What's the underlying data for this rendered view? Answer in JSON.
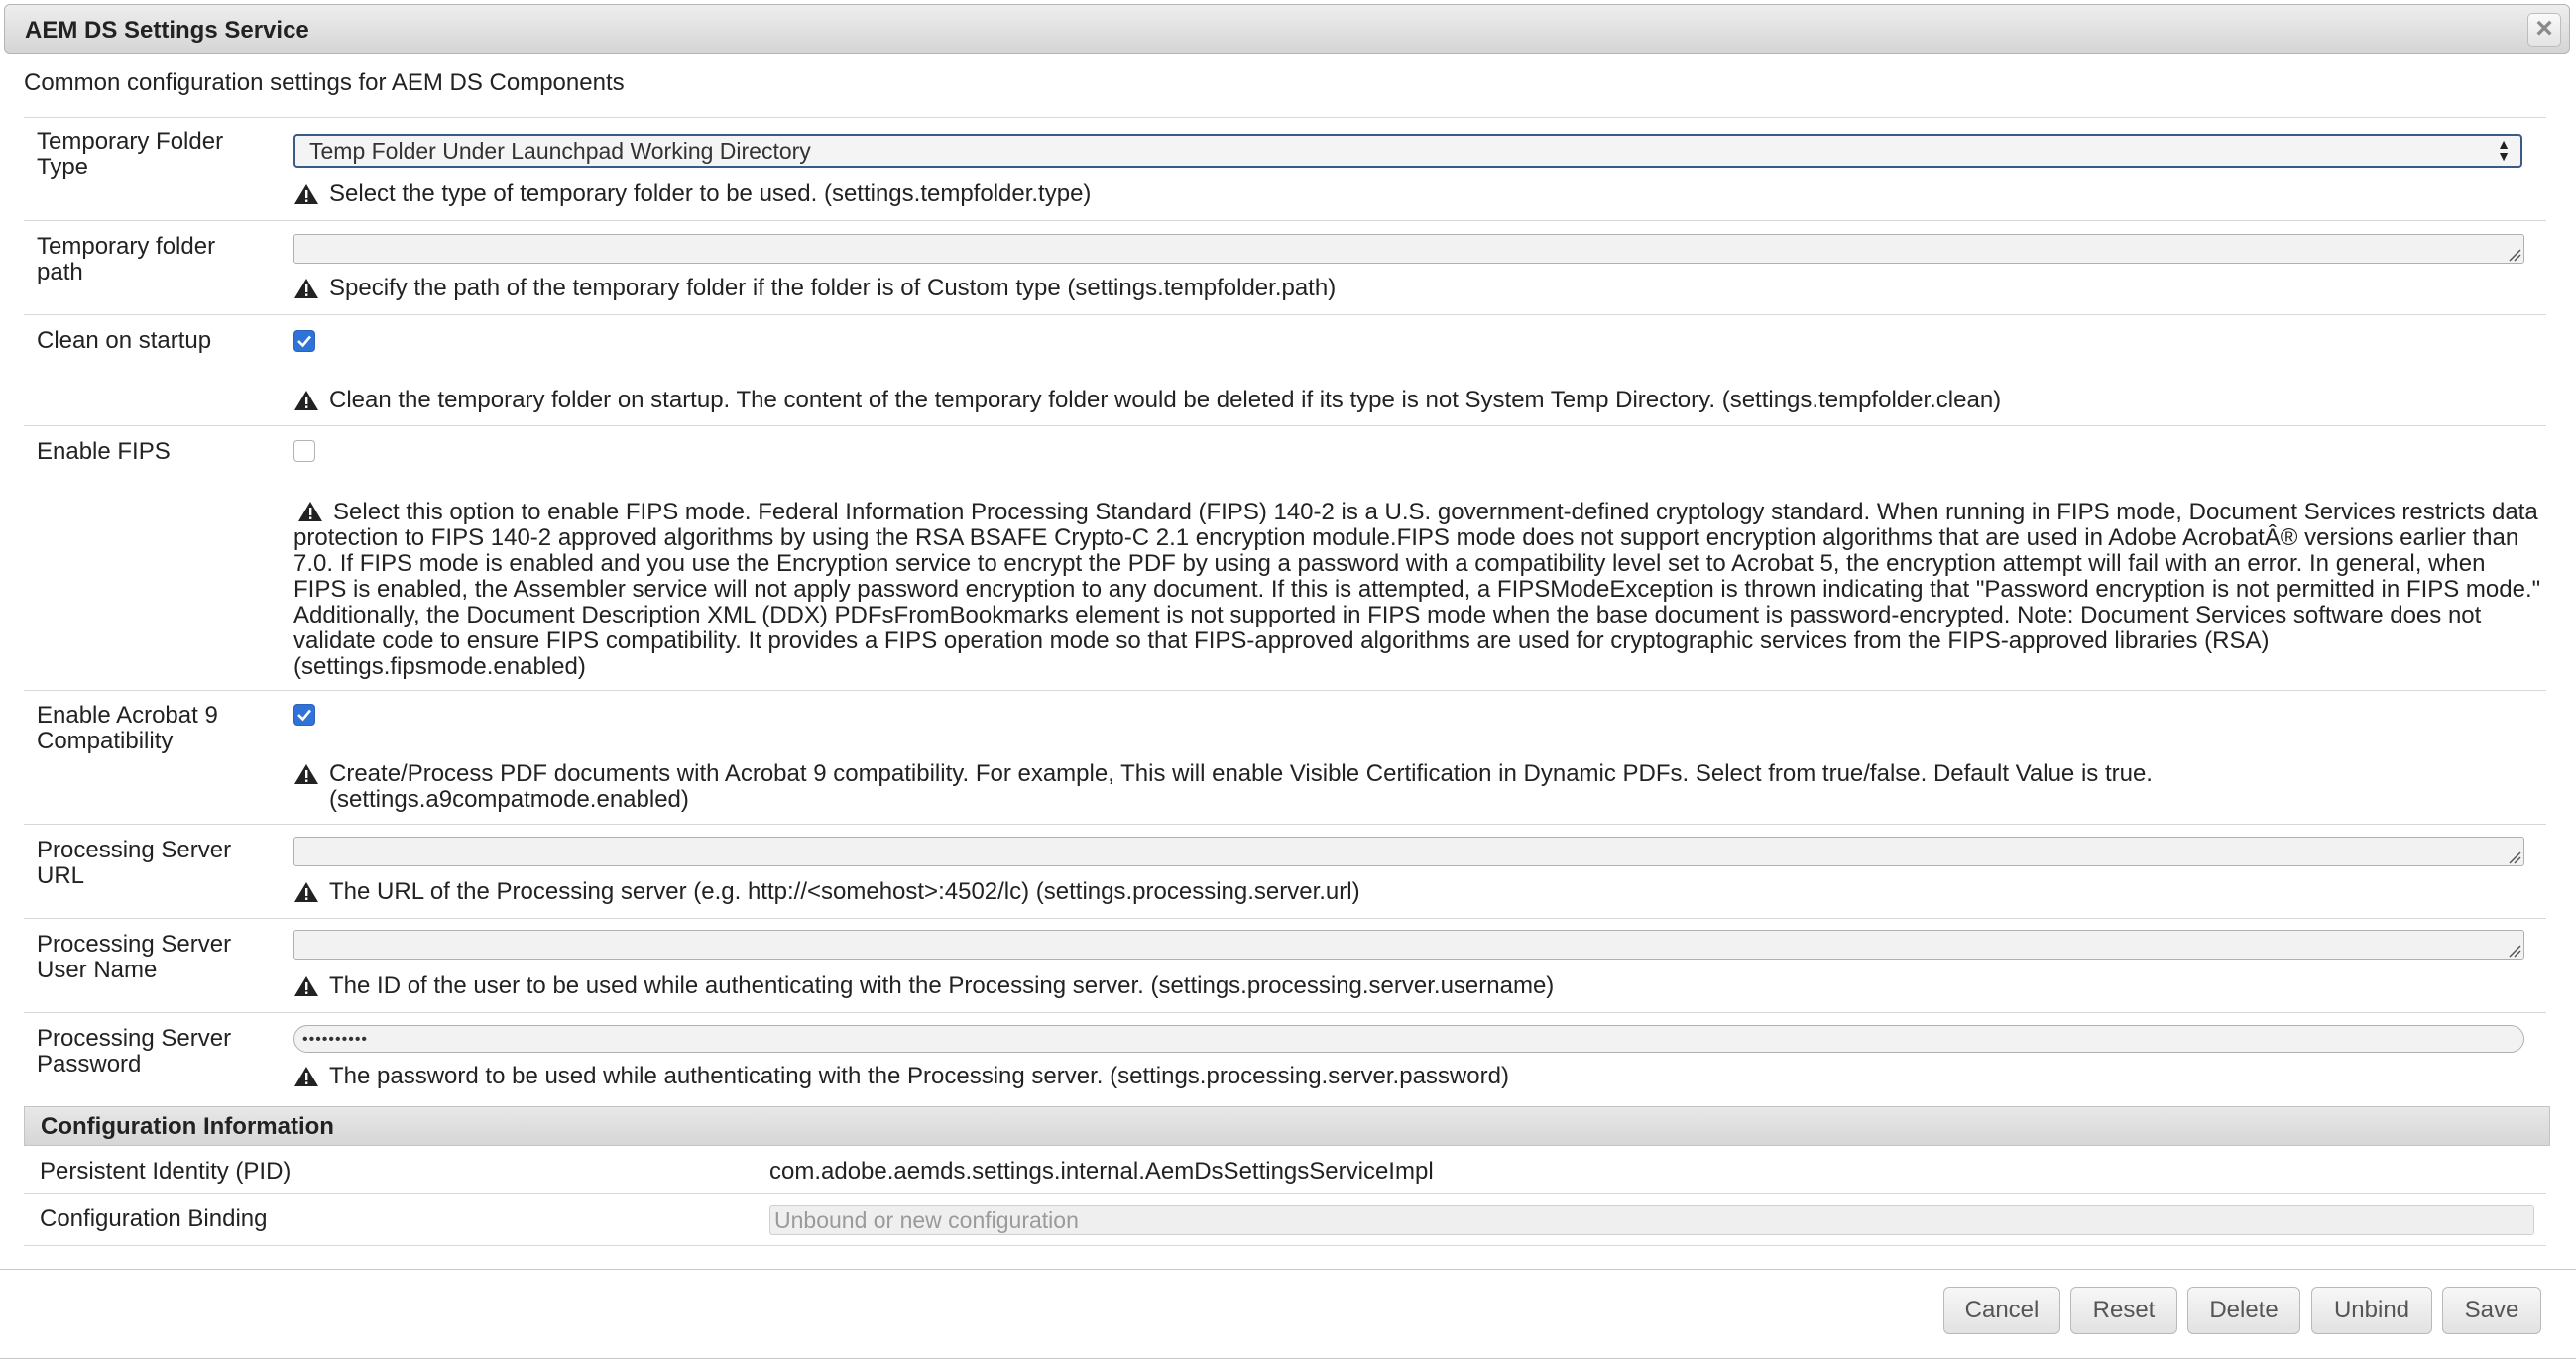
{
  "dialog": {
    "title": "AEM DS Settings Service",
    "close_label": "×",
    "description": "Common configuration settings for AEM DS Components"
  },
  "fields": [
    {
      "label": "Temporary Folder Type",
      "type": "select",
      "value": "Temp Folder Under Launchpad Working Directory",
      "hint": "Select the type of temporary folder to be used. (settings.tempfolder.type)"
    },
    {
      "label": "Temporary folder path",
      "type": "text",
      "value": "",
      "hint": "Specify the path of the temporary folder if the folder is of Custom type (settings.tempfolder.path)"
    },
    {
      "label": "Clean on startup",
      "type": "checkbox",
      "checked": true,
      "hint": "Clean the temporary folder on startup. The content of the temporary folder would be deleted if its type is not System Temp Directory. (settings.tempfolder.clean)"
    },
    {
      "label": "Enable FIPS",
      "type": "checkbox",
      "checked": false,
      "hint": "Select this option to enable FIPS mode. Federal Information Processing Standard (FIPS) 140-2 is a U.S. government-defined cryptology standard. When running in FIPS mode, Document Services restricts data protection to FIPS 140-2 approved algorithms by using the RSA BSAFE Crypto-C 2.1 encryption module.FIPS mode does not support encryption algorithms that are used in Adobe AcrobatÂ® versions earlier than 7.0. If FIPS mode is enabled and you use the Encryption service to encrypt the PDF by using a password with a compatibility level set to Acrobat 5, the encryption attempt will fail with an error. In general, when FIPS is enabled, the Assembler service will not apply password encryption to any document. If this is attempted, a FIPSModeException is thrown indicating that \"Password encryption is not permitted in FIPS mode.\" Additionally, the Document Description XML (DDX) PDFsFromBookmarks element is not supported in FIPS mode when the base document is password-encrypted. Note: Document Services software does not validate code to ensure FIPS compatibility. It provides a FIPS operation mode so that FIPS-approved algorithms are used for cryptographic services from the FIPS-approved libraries (RSA) (settings.fipsmode.enabled)"
    },
    {
      "label": "Enable Acrobat 9 Compatibility",
      "type": "checkbox",
      "checked": true,
      "hint": "Create/Process PDF documents with Acrobat 9 compatibility. For example, This will enable Visible Certification in Dynamic PDFs. Select from true/false. Default Value is true. (settings.a9compatmode.enabled)"
    },
    {
      "label": "Processing Server URL",
      "type": "text",
      "value": "",
      "hint": "The URL of the Processing server (e.g. http://<somehost>:4502/lc) (settings.processing.server.url)"
    },
    {
      "label": "Processing Server User Name",
      "type": "text",
      "value": "",
      "hint": "The ID of the user to be used while authenticating with the Processing server. (settings.processing.server.username)"
    },
    {
      "label": "Processing Server Password",
      "type": "password",
      "value": "••••••••••",
      "hint": "The password to be used while authenticating with the Processing server. (settings.processing.server.password)"
    }
  ],
  "config_info": {
    "header": "Configuration Information",
    "pid_label": "Persistent Identity (PID)",
    "pid_value": "com.adobe.aemds.settings.internal.AemDsSettingsServiceImpl",
    "binding_label": "Configuration Binding",
    "binding_placeholder": "Unbound or new configuration"
  },
  "buttons": {
    "cancel": "Cancel",
    "reset": "Reset",
    "delete": "Delete",
    "unbind": "Unbind",
    "save": "Save"
  },
  "colors": {
    "checkbox_checked": "#2f73d8",
    "select_border": "#3a5a88"
  }
}
